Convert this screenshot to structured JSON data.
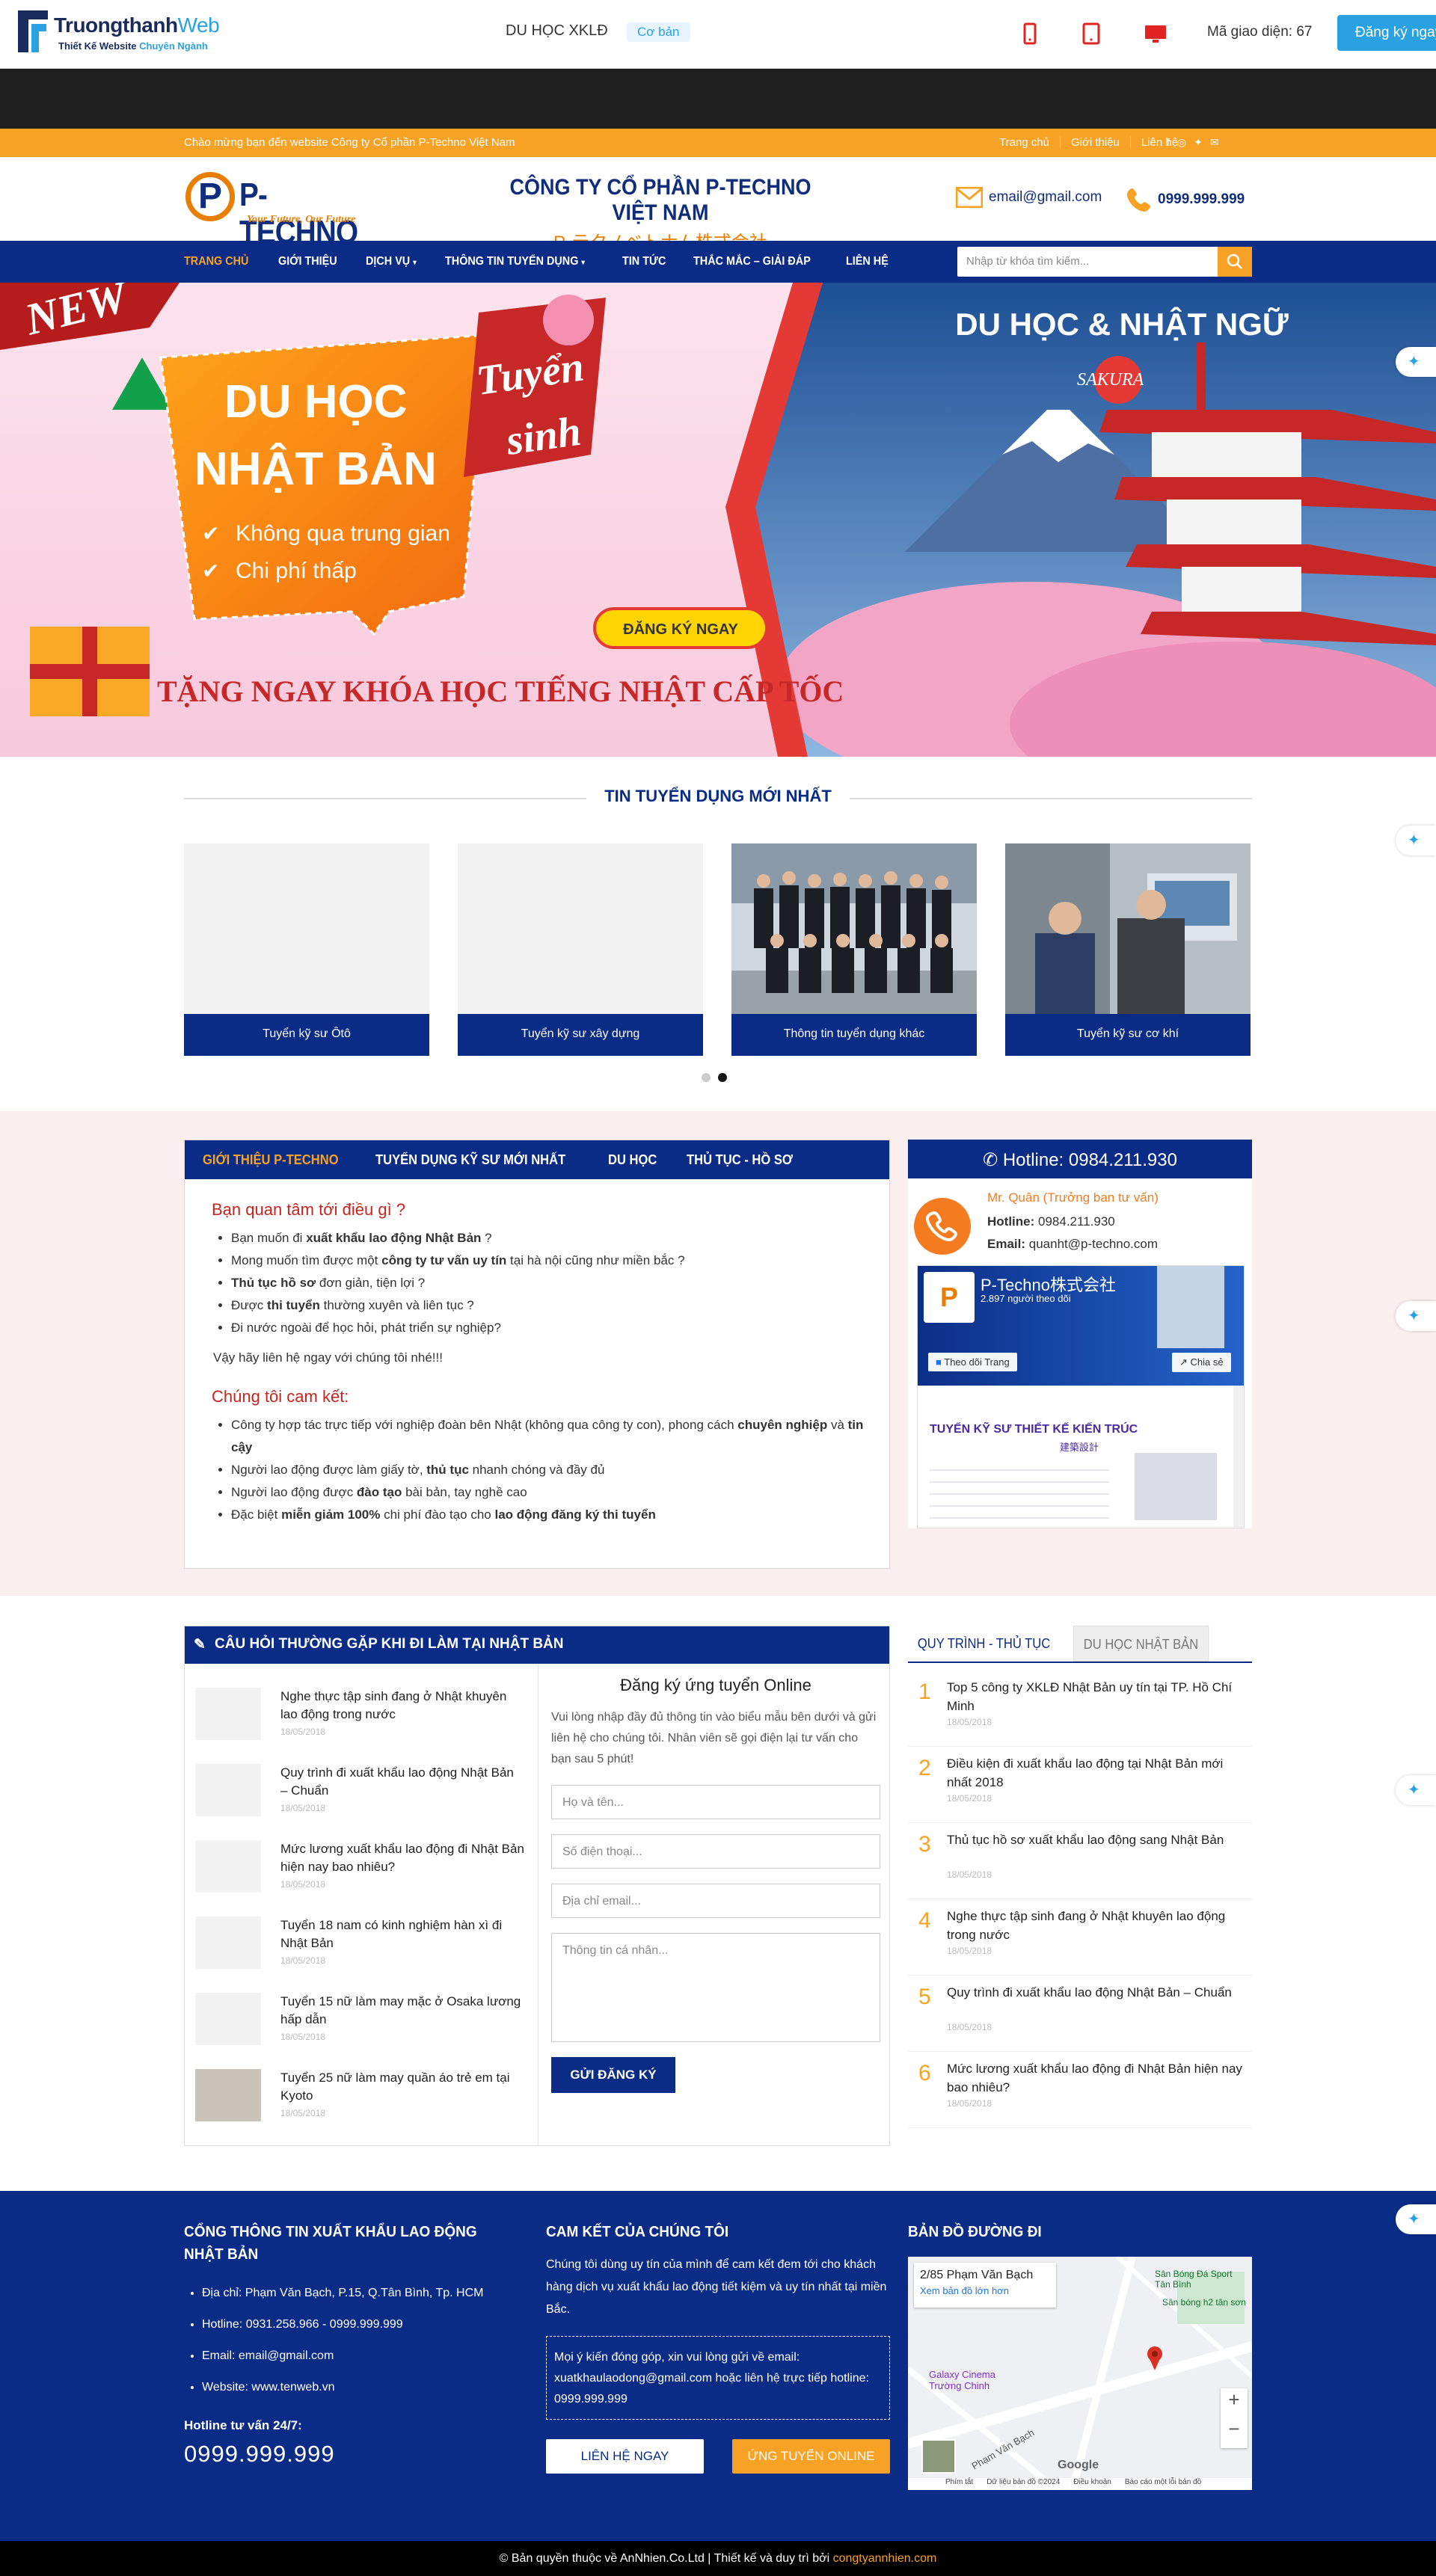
{
  "toolbar": {
    "brand_a": "Truongthanh",
    "brand_b": "Web",
    "tag_a": "Thiết Kế Website ",
    "tag_b": "Chuyên Ngành",
    "category": "DU HỌC XKLĐ",
    "chip": "Cơ bản",
    "code": "Mã giao diện: 67",
    "register": "Đăng ký ngay"
  },
  "topbar": {
    "welcome": "Chào mừng bạn đến website Công ty Cổ phần P-Techno Việt Nam",
    "links": [
      "Trang chủ",
      "Giới thiệu",
      "Liên hệ"
    ],
    "social": [
      "facebook-icon",
      "instagram-icon",
      "twitter-icon",
      "mail-icon"
    ]
  },
  "header": {
    "logo_letter": "P",
    "logo_name": "P-TECHNO",
    "slogan": "Your Future, Our Future",
    "company": "CÔNG TY CỔ PHẦN P-TECHNO VIỆT NAM",
    "company_jp": "P-テクノベトナム株式会社",
    "email": "email@gmail.com",
    "phone": "0999.999.999"
  },
  "nav": {
    "items": [
      "TRANG CHỦ",
      "GIỚI THIỆU",
      "DỊCH VỤ",
      "THÔNG TIN TUYỂN DỤNG",
      "TIN TỨC",
      "THẮC MẮC – GIẢI ĐÁP",
      "LIÊN HỆ"
    ],
    "search_placeholder": "Nhập từ khóa tìm kiếm..."
  },
  "hero": {
    "new": "NEW",
    "line1": "DU HỌC",
    "line2": "NHẬT BẢN",
    "tag1": "Tuyển",
    "tag2": "sinh",
    "bullet1": "Không qua trung gian",
    "bullet2": "Chi phí thấp",
    "cta": "ĐĂNG KÝ NGAY",
    "promo": "TẶNG NGAY KHÓA HỌC TIẾNG NHẬT CẤP TỐC",
    "right_title": "DU HỌC & NHẬT NGỮ",
    "sakura": "SAKURA"
  },
  "jobs": {
    "title": "TIN TUYỂN DỤNG MỚI NHẤT",
    "cards": [
      "Tuyển kỹ sư Ôtô",
      "Tuyển kỹ sư xây dựng",
      "Thông tin tuyển dụng khác",
      "Tuyển kỹ sư cơ khí"
    ]
  },
  "about": {
    "tabs": [
      "GIỚI THIỆU P-TECHNO",
      "TUYỂN DỤNG KỸ SƯ MỚI NHẤT",
      "DU HỌC",
      "THỦ TỤC - HỒ SƠ"
    ],
    "h1": "Bạn quan tâm tới điều gì ?",
    "q1a": "Bạn muốn đi ",
    "q1b": "xuất khẩu lao động Nhật Bản",
    "q1c": " ?",
    "q2a": "Mong muốn tìm được một ",
    "q2b": "công ty tư vấn uy tín",
    "q2c": " tại hà nội cũng như miền bắc ?",
    "q3a": "Thủ tục hồ sơ",
    "q3b": " đơn giản, tiện lợi ?",
    "q4a": "Được ",
    "q4b": "thi tuyển",
    "q4c": " thường xuyên và liên tục ?",
    "q5": "Đi nước ngoài để học hỏi, phát triển sự nghiệp?",
    "contact": "Vậy hãy liên hệ ngay với chúng tôi nhé!!!",
    "h2": "Chúng tôi cam kết:",
    "c1a": "Công ty hợp tác trực tiếp với nghiệp đoàn bên Nhật (không qua công ty con), phong cách ",
    "c1b": "chuyên nghiệp",
    "c1c": " và ",
    "c1d": "tin cậy",
    "c2a": "Người lao động được làm giấy tờ, ",
    "c2b": "thủ tục",
    "c2c": " nhanh chóng và đầy đủ",
    "c3a": "Người lao động được ",
    "c3b": "đào tạo",
    "c3c": " bài bản, tay nghề cao",
    "c4a": "Đặc biệt ",
    "c4b": "miễn giảm 100%",
    "c4c": " chi phí đào tạo cho ",
    "c4d": "lao động đăng ký thi tuyển"
  },
  "hotline": {
    "title": "Hotline: 0984.211.930",
    "name": "Mr. Quân (Trưởng ban tư vấn)",
    "hotline_label": "Hotline:",
    "hotline_value": "0984.211.930",
    "email_label": "Email:",
    "email_value": "quanht@p-techno.com",
    "fb_name": "P-Techno株式会社",
    "fb_followers": "2.897 người theo dõi",
    "fb_follow": "Theo dõi Trang",
    "fb_share": "Chia sẻ",
    "fb_post_title": "TUYỂN KỸ SƯ THIẾT KẾ KIẾN TRÚC",
    "fb_post_jp": "建築設計"
  },
  "faq": {
    "title": "CÂU HỎI THƯỜNG GẶP KHI ĐI LÀM TẠI NHẬT BẢN",
    "items": [
      {
        "title": "Nghe thực tập sinh đang ở Nhật khuyên lao động trong nước",
        "date": "18/05/2018"
      },
      {
        "title": "Quy trình đi xuất khẩu lao động Nhật Bản – Chuẩn",
        "date": "18/05/2018"
      },
      {
        "title": "Mức lương xuất khẩu lao động đi Nhật Bản hiện nay bao nhiêu?",
        "date": "18/05/2018"
      },
      {
        "title": "Tuyển 18 nam có kinh nghiệm hàn xì đi Nhật Bản",
        "date": "18/05/2018"
      },
      {
        "title": "Tuyển 15 nữ làm may mặc ở Osaka lương hấp dẫn",
        "date": "18/05/2018"
      },
      {
        "title": "Tuyển 25 nữ làm may quần áo trẻ em tại Kyoto",
        "date": "18/05/2018"
      }
    ]
  },
  "form": {
    "title": "Đăng ký ứng tuyển Online",
    "desc": "Vui lòng nhập đầy đủ thông tin vào biểu mẫu bên dưới và gửi liên hệ cho chúng tôi. Nhân viên sẽ gọi điện lại tư vấn cho bạn sau 5 phút!",
    "name_ph": "Họ và tên...",
    "phone_ph": "Số điện thoại...",
    "email_ph": "Địa chỉ email...",
    "info_ph": "Thông tin cá nhân...",
    "submit": "GỬI ĐĂNG KÝ"
  },
  "procedure": {
    "tab_active": "QUY TRÌNH - THỦ TỤC",
    "tab_other": "DU HỌC NHẬT BẢN",
    "items": [
      {
        "n": "1",
        "title": "Top 5 công ty XKLĐ Nhật Bản uy tín tại TP. Hồ Chí Minh",
        "date": "18/05/2018"
      },
      {
        "n": "2",
        "title": "Điều kiện đi xuất khẩu lao động tại Nhật Bản mới nhất 2018",
        "date": "18/05/2018"
      },
      {
        "n": "3",
        "title": "Thủ tục hồ sơ xuất khẩu lao động sang Nhật Bản",
        "date": "18/05/2018"
      },
      {
        "n": "4",
        "title": "Nghe thực tập sinh đang ở Nhật khuyên lao động trong nước",
        "date": "18/05/2018"
      },
      {
        "n": "5",
        "title": "Quy trình đi xuất khẩu lao động Nhật Bản – Chuẩn",
        "date": "18/05/2018"
      },
      {
        "n": "6",
        "title": "Mức lương xuất khẩu lao động đi Nhật Bản hiện nay bao nhiêu?",
        "date": "18/05/2018"
      }
    ]
  },
  "footer": {
    "col1_title": "CỔNG THÔNG TIN XUẤT KHẨU LAO ĐỘNG NHẬT BẢN",
    "address": "Địa chỉ: Phạm Văn Bạch, P.15, Q.Tân Bình, Tp. HCM",
    "hotline": "Hotline: 0931.258.966 - 0999.999.999",
    "email": "Email: email@gmail.com",
    "website": "Website: www.tenweb.vn",
    "hotline_label": "Hotline tư vấn 24/7:",
    "hotline_big": "0999.999.999",
    "col2_title": "CAM KẾT CỦA CHÚNG TÔI",
    "commit": "Chúng tôi dùng uy tín của mình để cam kết đem tới cho khách hàng dịch vụ xuất khẩu lao động tiết kiệm và uy tín nhất tại miền Bắc.",
    "notice": "Mọi ý kiến đóng góp, xin vui lòng gửi về email: xuatkhaulaodong@gmail.com hoặc liên hệ trực tiếp hotline: 0999.999.999",
    "btn_contact": "LIÊN HỆ NGAY",
    "btn_apply": "ỨNG TUYỂN ONLINE",
    "col3_title": "BẢN ĐỒ ĐƯỜNG ĐI",
    "map_addr": "2/85 Phạm Văn Bạch",
    "map_link": "Xem bản đồ lớn hơn",
    "map_poi1": "Sân Bóng Đá Sport Tân Bình",
    "map_poi2": "Sân bóng h2 tân sơn",
    "map_poi3": "Galaxy Cinema Trường Chinh",
    "map_road": "Phạm Văn Bạch",
    "map_zoom_in": "+",
    "map_zoom_out": "−",
    "map_google": "Google",
    "map_foot1": "Phím tắt",
    "map_foot2": "Dữ liệu bản đồ ©2024",
    "map_foot3": "Điều khoản",
    "map_foot4": "Báo cáo một lỗi bản đồ"
  },
  "copyright": {
    "text": "© Bản quyền thuộc về AnNhien.Co.Ltd  |  Thiết kế và duy trì bởi ",
    "link": "congtyannhien.com"
  }
}
